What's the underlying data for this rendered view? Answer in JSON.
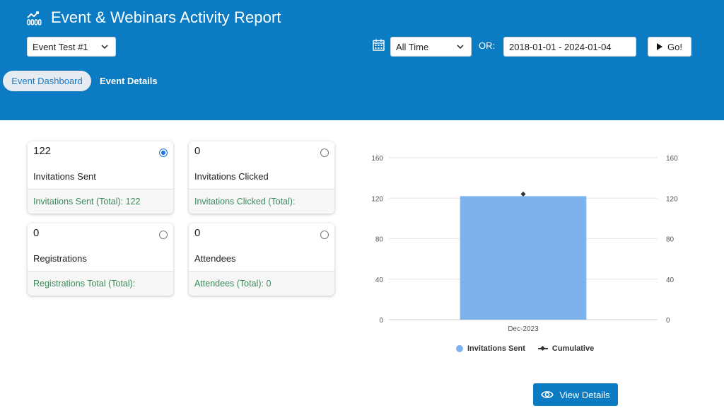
{
  "header": {
    "title": "Event & Webinars Activity Report",
    "title_icon": "line-chart-icon",
    "event_select": {
      "value": "Event Test #1"
    },
    "time_select": {
      "value": "All Time"
    },
    "or_label": "OR:",
    "date_range": {
      "value": "2018-01-01 - 2024-01-04"
    },
    "go_label": "Go!",
    "tabs": [
      {
        "label": "Event Dashboard",
        "active": true
      },
      {
        "label": "Event Details",
        "active": false
      }
    ]
  },
  "cards": [
    {
      "value": "122",
      "label": "Invitations Sent",
      "footer": "Invitations Sent (Total): 122",
      "selected": true
    },
    {
      "value": "0",
      "label": "Invitations Clicked",
      "footer": "Invitations Clicked (Total):",
      "selected": false
    },
    {
      "value": "0",
      "label": "Registrations",
      "footer": "Registrations Total (Total):",
      "selected": false
    },
    {
      "value": "0",
      "label": "Attendees",
      "footer": "Attendees (Total): 0",
      "selected": false
    }
  ],
  "chart_data": {
    "type": "bar",
    "categories": [
      "Dec-2023"
    ],
    "series": [
      {
        "name": "Invitations Sent",
        "type": "bar",
        "values": [
          122
        ],
        "color": "#7cb3ec"
      },
      {
        "name": "Cumulative",
        "type": "line",
        "values": [
          122
        ],
        "color": "#333333"
      }
    ],
    "ylim": [
      0,
      160
    ],
    "yticks": [
      0,
      40,
      80,
      120,
      160
    ],
    "right_axis_ticks": [
      0,
      40,
      80,
      120,
      160
    ],
    "grid": true,
    "legend": "bottom"
  },
  "actions": {
    "view_details_label": "View Details"
  }
}
